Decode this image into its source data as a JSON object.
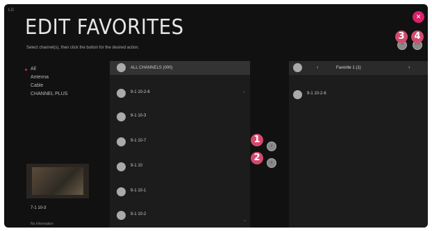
{
  "brand": "LG",
  "title": "EDIT FAVORITES",
  "subtitle": "Select channel(s), then click the button for the desired action.",
  "close_icon": "close-icon",
  "callouts": [
    "1",
    "2",
    "3",
    "4"
  ],
  "categories": [
    {
      "label": "All",
      "selected": true
    },
    {
      "label": "Antenna",
      "selected": false
    },
    {
      "label": "Cable",
      "selected": false
    },
    {
      "label": "CHANNEL PLUS",
      "selected": false
    }
  ],
  "preview": {
    "channel": "7-1 10-3",
    "info": "No Information"
  },
  "channel_list": {
    "header": "ALL CHANNELS (000)",
    "items": [
      "9-1 10-2-6",
      "9-1 10-3",
      "9-1 10-7",
      "9-1 10",
      "9-1 10-1",
      "9-1 10-2"
    ]
  },
  "favorites": {
    "title": "Favorite 1 (1)",
    "prev": "‹",
    "next": "›",
    "items": [
      "9-1 10-2-6"
    ]
  },
  "colors": {
    "accent": "#d8216a",
    "callout": "#d24a6e",
    "panel": "#1c1c1c"
  }
}
